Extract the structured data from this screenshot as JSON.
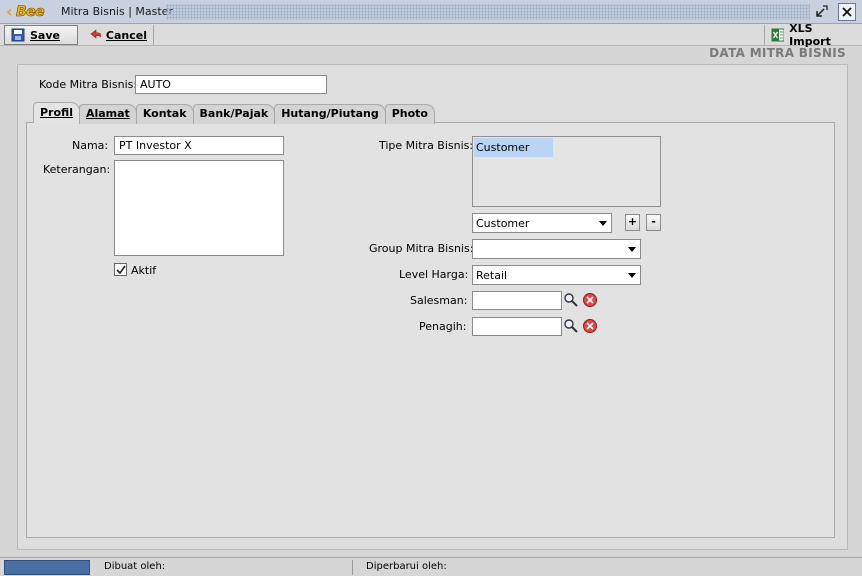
{
  "window": {
    "logo_text": "Bee",
    "title": "Mitra Bisnis | Master",
    "restore_icon": "restore-icon",
    "close_icon": "close-icon"
  },
  "toolbar": {
    "save_label": "Save",
    "cancel_label": "Cancel",
    "xls_import_label": "XLS Import"
  },
  "form_title": "DATA MITRA BISNIS",
  "header": {
    "kode_label": "Kode Mitra Bisnis:",
    "kode_value": "AUTO"
  },
  "tabs": [
    {
      "label": "Profil",
      "active": true
    },
    {
      "label": "Alamat",
      "active": false
    },
    {
      "label": "Kontak",
      "active": false
    },
    {
      "label": "Bank/Pajak",
      "active": false
    },
    {
      "label": "Hutang/Piutang",
      "active": false
    },
    {
      "label": "Photo",
      "active": false
    }
  ],
  "profil": {
    "nama_label": "Nama:",
    "nama_value": "PT Investor X",
    "keterangan_label": "Keterangan:",
    "keterangan_value": "",
    "aktif_label": "Aktif",
    "aktif_checked": true,
    "tipe_label": "Tipe Mitra Bisnis:",
    "tipe_list": [
      "Customer"
    ],
    "tipe_select": "Customer",
    "add_label": "+",
    "remove_label": "-",
    "group_label": "Group Mitra Bisnis:",
    "group_value": "",
    "level_label": "Level Harga:",
    "level_value": "Retail",
    "salesman_label": "Salesman:",
    "salesman_value": "",
    "penagih_label": "Penagih:",
    "penagih_value": ""
  },
  "statusbar": {
    "dibuat_label": "Dibuat oleh:",
    "diperbarui_label": "Diperbarui oleh:"
  },
  "colors": {
    "titlebar": "#c9d1e0",
    "selected_item": "#b9d5f3",
    "status_accent": "#4a6fa5",
    "logo": "#f5b400"
  }
}
